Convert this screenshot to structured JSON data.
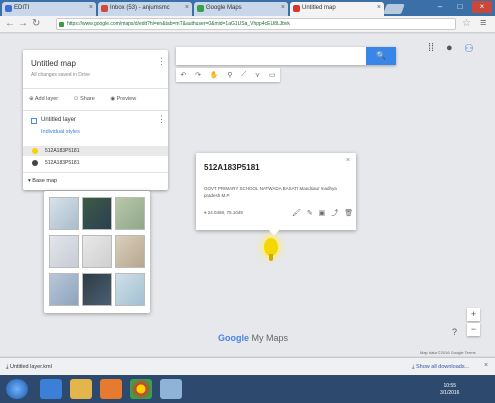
{
  "browser": {
    "tabs": [
      {
        "label": "EDITI",
        "favicon_color": "#3a6fd1"
      },
      {
        "label": "Inbox (53) - anjumsmc",
        "favicon_color": "#d04a3a"
      },
      {
        "label": "Google Maps",
        "favicon_color": "#3aa04a"
      },
      {
        "label": "Untitled map",
        "favicon_color": "#d9352b"
      }
    ],
    "url": "https://www.google.com/maps/d/edit?hl=en&tab=mT&authuser=0&mid=1aG1USa_Vhpp4cEU8LJbvk"
  },
  "panel": {
    "title": "Untitled map",
    "subtitle": "All changes saved in Drive",
    "actions": [
      "Add layer",
      "Share",
      "Preview"
    ],
    "layer_name": "Untitled layer",
    "style_link": "Individual styles",
    "items": [
      "512A183P5181",
      "512A183P5181"
    ],
    "basemap_label": "Base map"
  },
  "infowindow": {
    "title": "512A183P5181",
    "description": "GOVT PRIMARY SCHOOL NATWADA BASATI Mandsaur madhya pradesh M.P.",
    "coords": "24.0468, 75.1049"
  },
  "map": {
    "brand_google": "Google",
    "brand_mymaps": "My Maps",
    "attribution": "Map data ©2016 Google  Terms",
    "zoom_in": "+",
    "zoom_out": "−",
    "help": "?"
  },
  "downloads": {
    "item": "Untitled layer.kml",
    "show_all": "Show all downloads...",
    "close": "×"
  },
  "taskbar": {
    "time": "10:55",
    "date": "3/1/2016"
  },
  "colors": {
    "accent": "#3a85e8",
    "marker": "#f5d800"
  }
}
